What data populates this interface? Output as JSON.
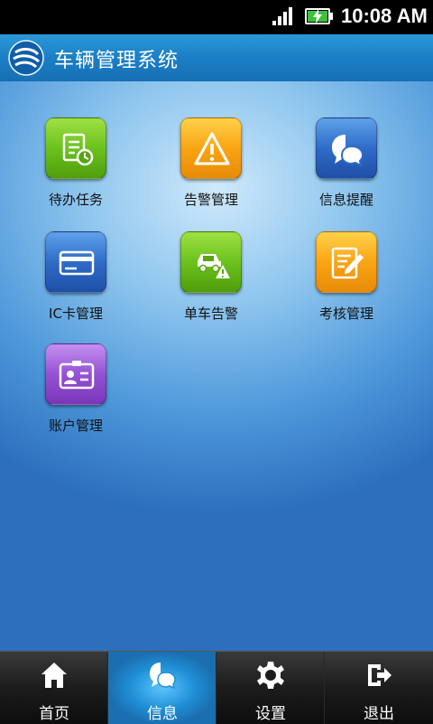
{
  "status_bar": {
    "time": "10:08 AM"
  },
  "header": {
    "title": "车辆管理系统",
    "logo_icon": "china-mobile-logo-icon"
  },
  "grid": {
    "items": [
      {
        "label": "待办任务",
        "icon": "task-list-icon",
        "color": "#6cc21d"
      },
      {
        "label": "告警管理",
        "icon": "warning-icon",
        "color": "#f9a514"
      },
      {
        "label": "信息提醒",
        "icon": "chat-bubble-icon",
        "color": "#2f6cc8"
      },
      {
        "label": "IC卡管理",
        "icon": "card-icon",
        "color": "#2f6cc8"
      },
      {
        "label": "单车告警",
        "icon": "car-warning-icon",
        "color": "#6cc21d"
      },
      {
        "label": "考核管理",
        "icon": "edit-document-icon",
        "color": "#f9a514"
      },
      {
        "label": "账户管理",
        "icon": "id-card-icon",
        "color": "#9552d3"
      }
    ]
  },
  "tabbar": {
    "items": [
      {
        "label": "首页",
        "icon": "home-icon",
        "active": false
      },
      {
        "label": "信息",
        "icon": "chat-bubble-icon",
        "active": true
      },
      {
        "label": "设置",
        "icon": "gear-icon",
        "active": false
      },
      {
        "label": "退出",
        "icon": "logout-icon",
        "active": false
      }
    ]
  }
}
